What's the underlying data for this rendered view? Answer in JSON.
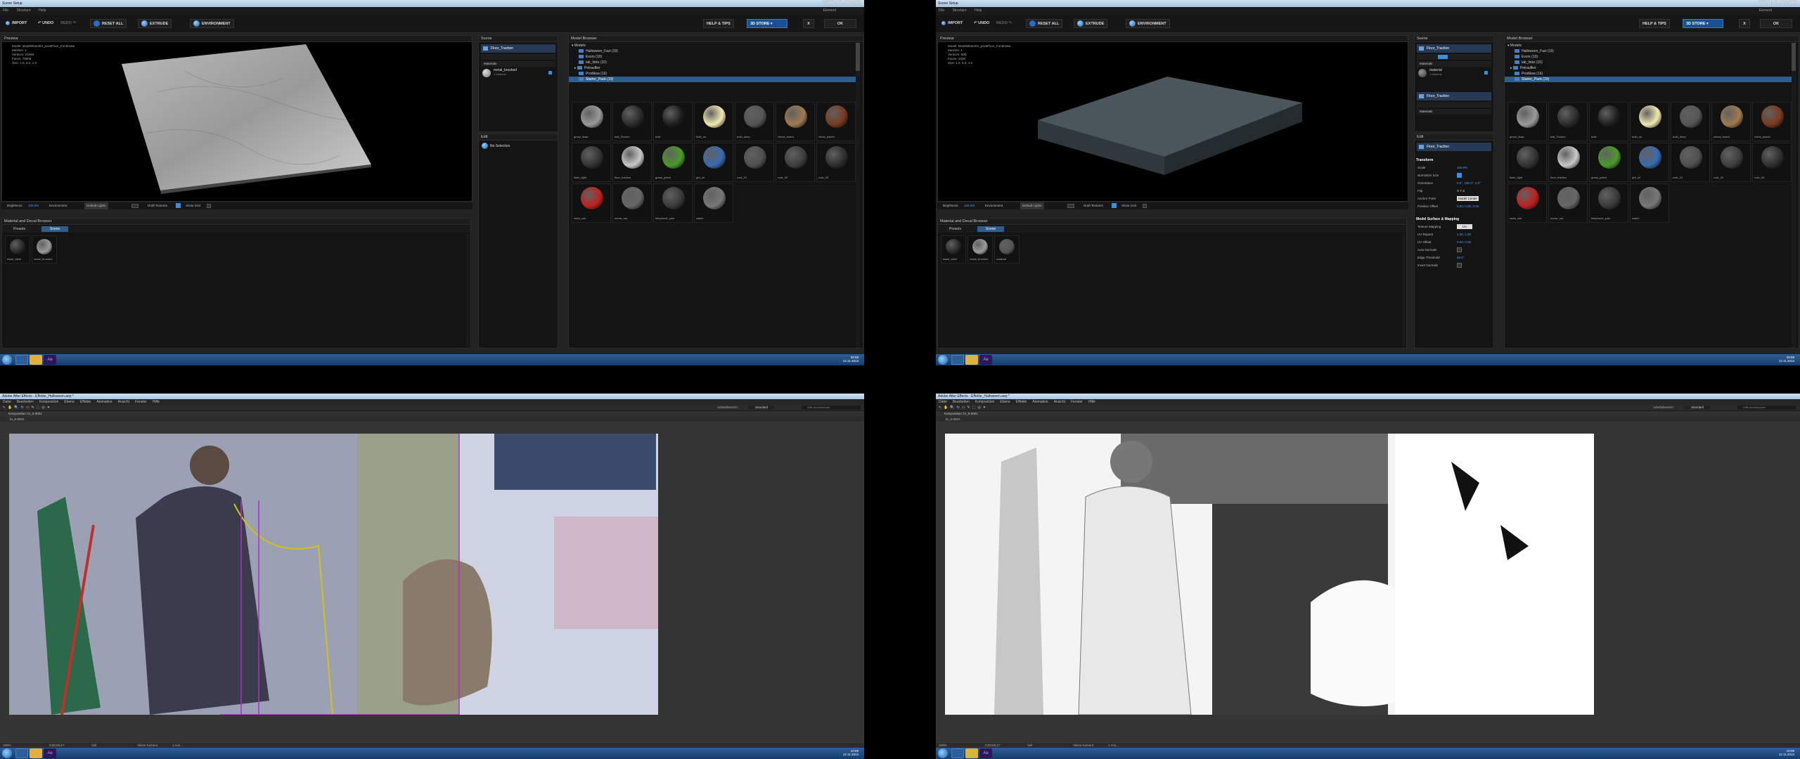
{
  "bodypaint": {
    "title": "Scene Setup",
    "hsv_line1": "Valmise 8TH 7585Q6080",
    "hsv_line2": "0.5.0 / Tc 5.02 120 Rote",
    "menu": [
      "File",
      "Structure",
      "Help"
    ],
    "menu_right": "Element",
    "toolbar": {
      "import": "IMPORT",
      "undo": "UNDO",
      "redo": "REDO",
      "reset": "RESET ALL",
      "extrude": "EXTRUDE",
      "environment": "ENVIRONMENT",
      "help": "HELP & TIPS",
      "store": "3D STORE",
      "close": "X",
      "ok": "OK"
    },
    "preview": {
      "header": "Preview",
      "info": [
        "Model: Modelsltutorlet_pointFloor_Fondmala",
        "Meshes: 1",
        "Vertices: 21848",
        "Faces: 78808",
        "Size: 1.0, 0.2, 1.0"
      ],
      "brightness_label": "Brightness:",
      "brightness_value": "100.0%",
      "environment_label": "Environment",
      "environment_value": "Default Lights",
      "draft_label": "Draft Textures",
      "show_grid_label": "Show Grid"
    },
    "scene": {
      "header": "Scene",
      "name": "Floor_Traction",
      "materials_label": "Materials",
      "material_name": "metal_brushed",
      "material_sub": "1 Material"
    },
    "edit": {
      "header": "Edit",
      "no_selection": "No Selection"
    },
    "model_browser": {
      "header": "Model Browser",
      "root": "Models",
      "folders": [
        "Halloween_Fazi (19)",
        "Evors (10)",
        "lab_links (10)",
        "Petrauflier",
        "Prodikaa (16)",
        "Starter_Pack (19)"
      ],
      "items": [
        {
          "label": "ghost_dwar",
          "color": "#9a9a9a"
        },
        {
          "label": "ball_Textors",
          "color": "#2a2a2a"
        },
        {
          "label": "bulb",
          "color": "#1e1e1e"
        },
        {
          "label": "bulb_on",
          "color": "#f0eab0"
        },
        {
          "label": "bulb_deep",
          "color": "#555555"
        },
        {
          "label": "chess_board",
          "color": "#a07a50"
        },
        {
          "label": "chest_planet",
          "color": "#7a3a20"
        },
        {
          "label": "flash_light",
          "color": "#333333"
        },
        {
          "label": "floor_traction",
          "color": "#c8c8c8"
        },
        {
          "label": "grass_patch",
          "color": "#4a9a2a"
        },
        {
          "label": "grit_oil",
          "color": "#3a6ab0"
        },
        {
          "label": "rock_01",
          "color": "#505050"
        },
        {
          "label": "rock_02",
          "color": "#3e3e3e"
        },
        {
          "label": "rock_03",
          "color": "#2e2e2e"
        },
        {
          "label": "soda_can",
          "color": "#c02020"
        },
        {
          "label": "screw_nut",
          "color": "#666666"
        },
        {
          "label": "telephone_pole",
          "color": "#3a3a3a"
        },
        {
          "label": "watch",
          "color": "#777777"
        }
      ]
    },
    "material_browser": {
      "header": "Material and Decal Browser",
      "tab_presets": "Presets",
      "tab_scene": "Scene",
      "items": [
        {
          "label": "black_steel",
          "color": "#2a2a2a"
        },
        {
          "label": "metal_brushed",
          "color": "#9a9a9a"
        }
      ]
    },
    "taskbar": {
      "time": "09:58",
      "date": "12.11.2013"
    }
  },
  "bodypaint2": {
    "preview_info": [
      "Model: Modelsltutorlet_pointFloor_Fondmala",
      "Meshes: 1",
      "Vertices: 8(8)",
      "Faces: 10(8)",
      "Size: 1.0, 0.2, 1.0"
    ],
    "scene_name": "Floor_Traction",
    "scene_name2": "Floor_Traction",
    "material_name": "material",
    "transform": {
      "header": "Transform",
      "rows": [
        {
          "k": "Scale",
          "v": "100.0%"
        },
        {
          "k": "Normalize Size",
          "v": ""
        },
        {
          "k": "Orientation",
          "v": "0.0°, 180.0°, 0.0°"
        },
        {
          "k": "Flip",
          "v": "X  Y  Z"
        },
        {
          "k": "Anchor Point",
          "v": "Model Center"
        },
        {
          "k": "Position Offset",
          "v": "0.00, 0.00, 0.00"
        }
      ]
    },
    "surface": {
      "header": "Model Surface & Mapping",
      "rows": [
        {
          "k": "Texture Mapping",
          "v": "UV"
        },
        {
          "k": "UV Repeat",
          "v": "1.00, 1.00"
        },
        {
          "k": "UV Offset",
          "v": "0.00, 0.00"
        },
        {
          "k": "Auto Normals",
          "v": ""
        },
        {
          "k": "Edge Threshold",
          "v": "60.0°"
        },
        {
          "k": "Invert Normals",
          "v": ""
        }
      ]
    },
    "material_items": [
      {
        "label": "black_steel",
        "color": "#2a2a2a"
      },
      {
        "label": "metal_brushed",
        "color": "#9a9a9a"
      },
      {
        "label": "material",
        "color": "#555555"
      }
    ],
    "taskbar": {
      "time": "09:59",
      "date": "12.11.2013"
    }
  },
  "aftereffects": {
    "title": "Adobe After Effects - Effekte_Halloween.aep *",
    "menu": [
      "Datei",
      "Bearbeiten",
      "Komposition",
      "Ebene",
      "Effekte",
      "Animation",
      "Ansicht",
      "Fenster",
      "Hilfe"
    ],
    "workspace_label": "Arbeitsbereich:",
    "workspace_value": "Standard",
    "search_placeholder": "Hilfe durchsuchen",
    "comp_tab": "Komposition: br_5-0001",
    "comp_subtab": "br_5-0001",
    "zoom": "100%",
    "timecode": "0;00;05;17",
    "quality": "Voll",
    "camera": "Aktive Kamera",
    "views": "1 Ans...",
    "taskbar": {
      "time": "10:09",
      "date": "12.11.2013"
    }
  },
  "aftereffects2": {
    "taskbar": {
      "time": "10:09",
      "date": "12.11.2013"
    }
  }
}
